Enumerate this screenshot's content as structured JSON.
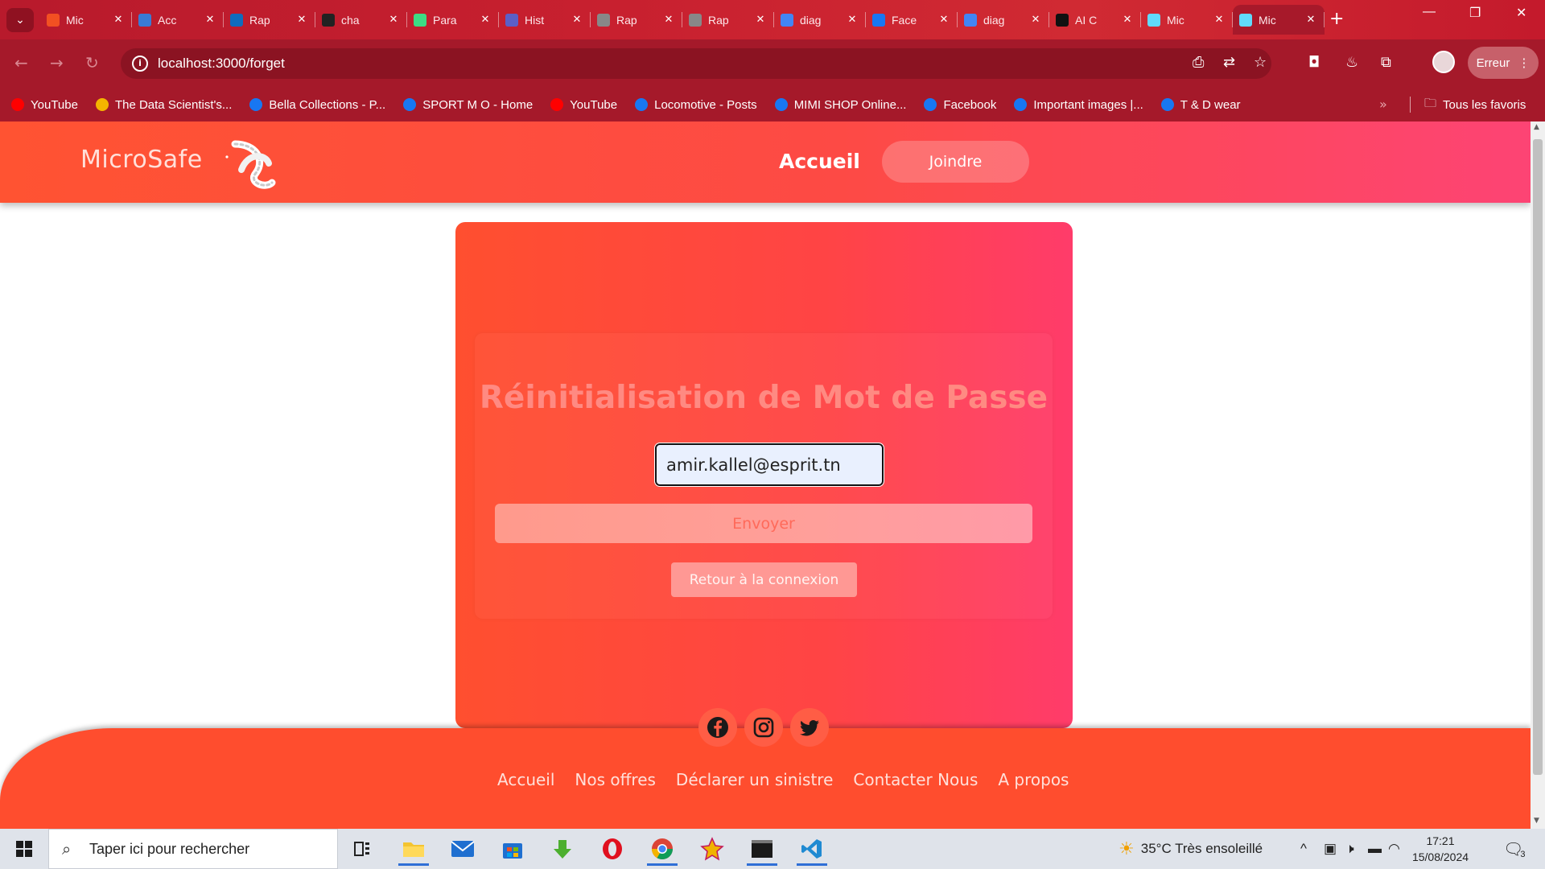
{
  "browser": {
    "tabs": [
      {
        "title": "Mic",
        "icon": "microsoft-icon",
        "color": "#f25022"
      },
      {
        "title": "Acc",
        "icon": "copilot-icon",
        "color": "#3a7bd5"
      },
      {
        "title": "Rap",
        "icon": "onedrive-icon",
        "color": "#0f6cbd"
      },
      {
        "title": "cha",
        "icon": "openai-icon",
        "color": "#222222"
      },
      {
        "title": "Para",
        "icon": "android-icon",
        "color": "#3ddc84"
      },
      {
        "title": "Hist",
        "icon": "person-icon",
        "color": "#5b5fc7"
      },
      {
        "title": "Rap",
        "icon": "globe-icon",
        "color": "#888888"
      },
      {
        "title": "Rap",
        "icon": "globe-icon",
        "color": "#888888"
      },
      {
        "title": "diag",
        "icon": "google-icon",
        "color": "#4285f4"
      },
      {
        "title": "Face",
        "icon": "facebook-icon",
        "color": "#1877f2"
      },
      {
        "title": "diag",
        "icon": "google-icon",
        "color": "#4285f4"
      },
      {
        "title": "AI C",
        "icon": "ai-icon",
        "color": "#111111"
      },
      {
        "title": "Mic",
        "icon": "react-icon",
        "color": "#61dafb"
      },
      {
        "title": "Mic",
        "icon": "react-icon",
        "color": "#61dafb"
      }
    ],
    "url": "localhost:3000/forget",
    "error_label": "Erreur",
    "bookmarks": [
      {
        "label": "YouTube",
        "icon": "youtube-icon",
        "color": "#ff0000"
      },
      {
        "label": "The Data Scientist's...",
        "icon": "drive-icon",
        "color": "#f4b400"
      },
      {
        "label": "Bella Collections - P...",
        "icon": "facebook-icon",
        "color": "#1877f2"
      },
      {
        "label": "SPORT M O - Home",
        "icon": "facebook-icon",
        "color": "#1877f2"
      },
      {
        "label": "YouTube",
        "icon": "youtube-icon",
        "color": "#ff0000"
      },
      {
        "label": "Locomotive - Posts",
        "icon": "facebook-icon",
        "color": "#1877f2"
      },
      {
        "label": "MIMI SHOP Online...",
        "icon": "facebook-icon",
        "color": "#1877f2"
      },
      {
        "label": "Facebook",
        "icon": "facebook-icon",
        "color": "#1877f2"
      },
      {
        "label": "Important images |...",
        "icon": "facebook-icon",
        "color": "#1877f2"
      },
      {
        "label": "T & D wear",
        "icon": "facebook-icon",
        "color": "#1877f2"
      }
    ],
    "all_bookmarks_label": "Tous les favoris"
  },
  "header": {
    "brand": "MicroSafe",
    "nav_home": "Accueil",
    "nav_join": "Joindre"
  },
  "form": {
    "title": "Réinitialisation de Mot de Passe",
    "email_value": "amir.kallel@esprit.tn",
    "send_label": "Envoyer",
    "back_label": "Retour à la connexion"
  },
  "footer": {
    "links": [
      "Accueil",
      "Nos offres",
      "Déclarer un sinistre",
      "Contacter Nous",
      "A propos"
    ]
  },
  "taskbar": {
    "search_placeholder": "Taper ici pour rechercher",
    "weather": "35°C  Très ensoleillé",
    "time": "17:21",
    "date": "15/08/2024",
    "notification_count": "3"
  },
  "colors": {
    "header_start": "#ff5332",
    "header_end": "#fd4474",
    "card": "#ff4445",
    "footer": "#ff4d2e",
    "browser_chrome": "#a5192a"
  }
}
